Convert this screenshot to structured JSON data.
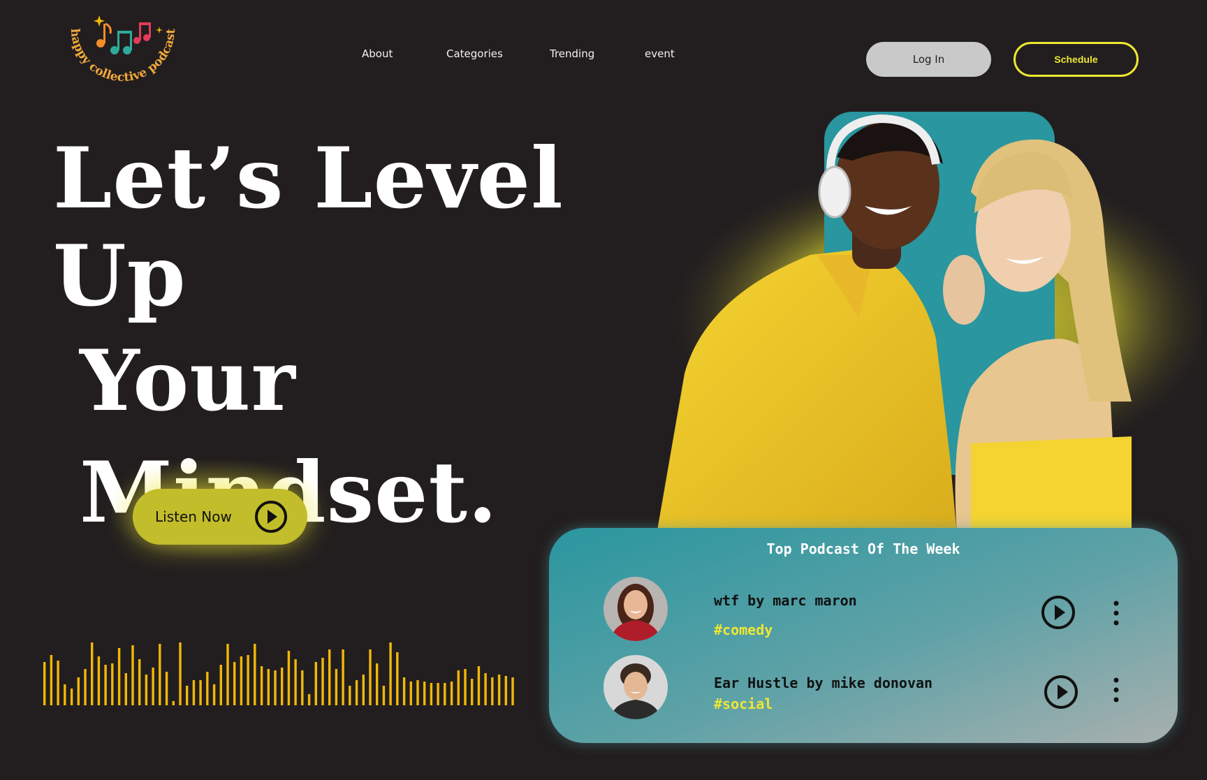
{
  "brand": {
    "name": "happy collective podcast"
  },
  "nav": {
    "items": [
      {
        "label": "About"
      },
      {
        "label": "Categories"
      },
      {
        "label": "Trending"
      },
      {
        "label": "event"
      }
    ],
    "login_label": "Log In",
    "schedule_label": "Schedule"
  },
  "hero": {
    "headline_line1": "Let’s Level Up",
    "headline_line2": "Your Mindset.",
    "listen_label": "Listen Now"
  },
  "top_podcasts": {
    "title": "Top Podcast Of The Week",
    "items": [
      {
        "name": "wtf by marc maron",
        "tag": "#comedy"
      },
      {
        "name": "Ear Hustle by mike donovan",
        "tag": "#social"
      }
    ]
  },
  "colors": {
    "background": "#221e1f",
    "accent_yellow": "#eee733",
    "teal": "#2a969f",
    "waveform": "#f2b807"
  },
  "icons": {
    "logo": "music-notes-icon",
    "play": "play-circle-icon",
    "more": "vertical-dots-icon"
  }
}
